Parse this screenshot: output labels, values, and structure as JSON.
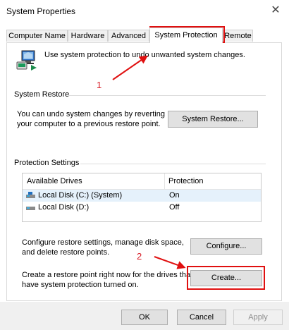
{
  "window": {
    "title": "System Properties",
    "close_glyph": "✕"
  },
  "tabs": [
    {
      "label": "Computer Name"
    },
    {
      "label": "Hardware"
    },
    {
      "label": "Advanced"
    },
    {
      "label": "System Protection",
      "active": true
    },
    {
      "label": "Remote"
    }
  ],
  "intro": {
    "text": "Use system protection to undo unwanted system changes.",
    "icon": "system-protection-icon"
  },
  "system_restore": {
    "group_label": "System Restore",
    "description_line1": "You can undo system changes by reverting",
    "description_line2": "your computer to a previous restore point.",
    "button_label": "System Restore..."
  },
  "protection_settings": {
    "group_label": "Protection Settings",
    "columns": [
      "Available Drives",
      "Protection"
    ],
    "drives": [
      {
        "name": "Local Disk (C:) (System)",
        "protection": "On",
        "selected": true,
        "icon": "system-drive-icon"
      },
      {
        "name": "Local Disk (D:)",
        "protection": "Off",
        "selected": false,
        "icon": "drive-icon"
      }
    ],
    "configure_line1": "Configure restore settings, manage disk space,",
    "configure_line2": "and delete restore points.",
    "configure_button": "Configure...",
    "create_line1": "Create a restore point right now for the drives that",
    "create_line2": "have system protection turned on.",
    "create_button": "Create..."
  },
  "footer": {
    "ok": "OK",
    "cancel": "Cancel",
    "apply": "Apply"
  },
  "annotations": {
    "step1": "1",
    "step2": "2",
    "color": "#e01010"
  }
}
